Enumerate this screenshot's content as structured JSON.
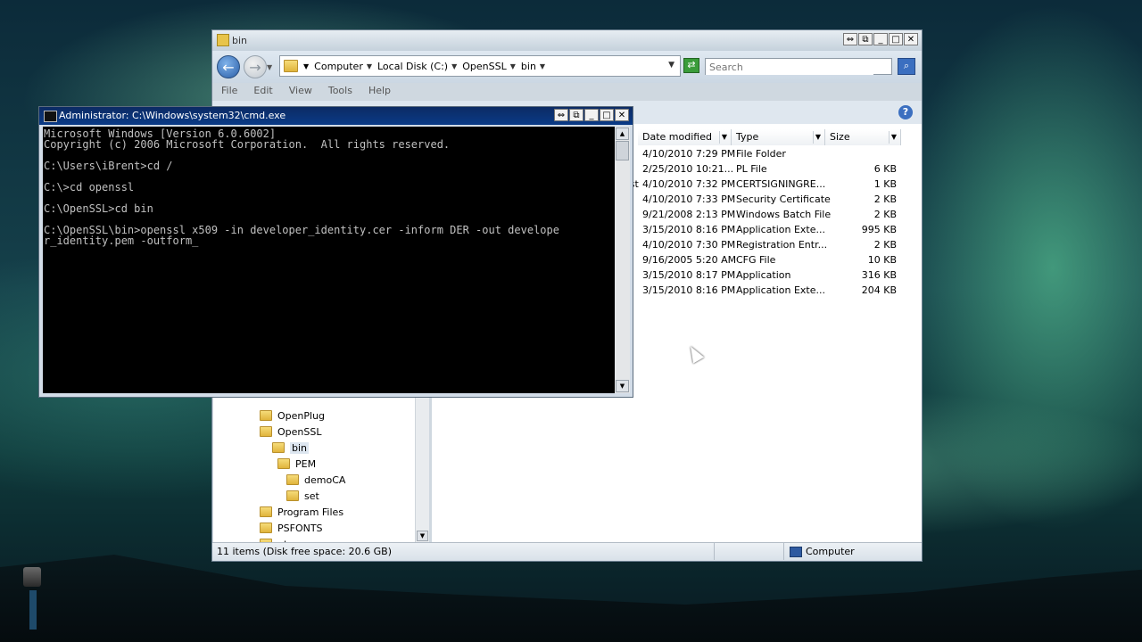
{
  "explorer": {
    "title": "bin",
    "address_crumbs": [
      "Computer",
      "Local Disk (C:)",
      "OpenSSL",
      "bin"
    ],
    "search_placeholder": "Search",
    "menu": [
      "File",
      "Edit",
      "View",
      "Tools",
      "Help"
    ],
    "columns": [
      "Date modified",
      "Type",
      "Size"
    ],
    "partial_name_fragment": "uest",
    "files": [
      {
        "date": "4/10/2010 7:29 PM",
        "type": "File Folder",
        "size": ""
      },
      {
        "date": "2/25/2010 10:21...",
        "type": "PL File",
        "size": "6 KB"
      },
      {
        "date": "4/10/2010 7:32 PM",
        "type": "CERTSIGNINGRE...",
        "size": "1 KB"
      },
      {
        "date": "4/10/2010 7:33 PM",
        "type": "Security Certificate",
        "size": "2 KB"
      },
      {
        "date": "9/21/2008 2:13 PM",
        "type": "Windows Batch File",
        "size": "2 KB"
      },
      {
        "date": "3/15/2010 8:16 PM",
        "type": "Application Exte...",
        "size": "995 KB"
      },
      {
        "date": "4/10/2010 7:30 PM",
        "type": "Registration Entr...",
        "size": "2 KB"
      },
      {
        "date": "9/16/2005 5:20 AM",
        "type": "CFG File",
        "size": "10 KB"
      },
      {
        "date": "3/15/2010 8:17 PM",
        "type": "Application",
        "size": "316 KB"
      },
      {
        "date": "3/15/2010 8:16 PM",
        "type": "Application Exte...",
        "size": "204 KB"
      }
    ],
    "tree": [
      {
        "label": "OpenPlug",
        "selected": false
      },
      {
        "label": "OpenSSL",
        "selected": false
      },
      {
        "label": "bin",
        "selected": true
      },
      {
        "label": "PEM",
        "selected": false
      },
      {
        "label": "demoCA",
        "selected": false
      },
      {
        "label": "set",
        "selected": false
      },
      {
        "label": "Program Files",
        "selected": false
      },
      {
        "label": "PSFONTS",
        "selected": false
      },
      {
        "label": "pt",
        "selected": false
      }
    ],
    "status_text": "11 items (Disk free space: 20.6 GB)",
    "status_location": "Computer"
  },
  "cmd": {
    "title": "Administrator: C:\\Windows\\system32\\cmd.exe",
    "lines": [
      "Microsoft Windows [Version 6.0.6002]",
      "Copyright (c) 2006 Microsoft Corporation.  All rights reserved.",
      "",
      "C:\\Users\\iBrent>cd /",
      "",
      "C:\\>cd openssl",
      "",
      "C:\\OpenSSL>cd bin",
      "",
      "C:\\OpenSSL\\bin>openssl x509 -in developer_identity.cer -inform DER -out develope",
      "r_identity.pem -outform_"
    ]
  },
  "icons": {
    "back": "back-arrow-icon",
    "forward": "forward-arrow-icon",
    "refresh": "refresh-icon",
    "search": "search-icon",
    "help": "help-icon"
  }
}
